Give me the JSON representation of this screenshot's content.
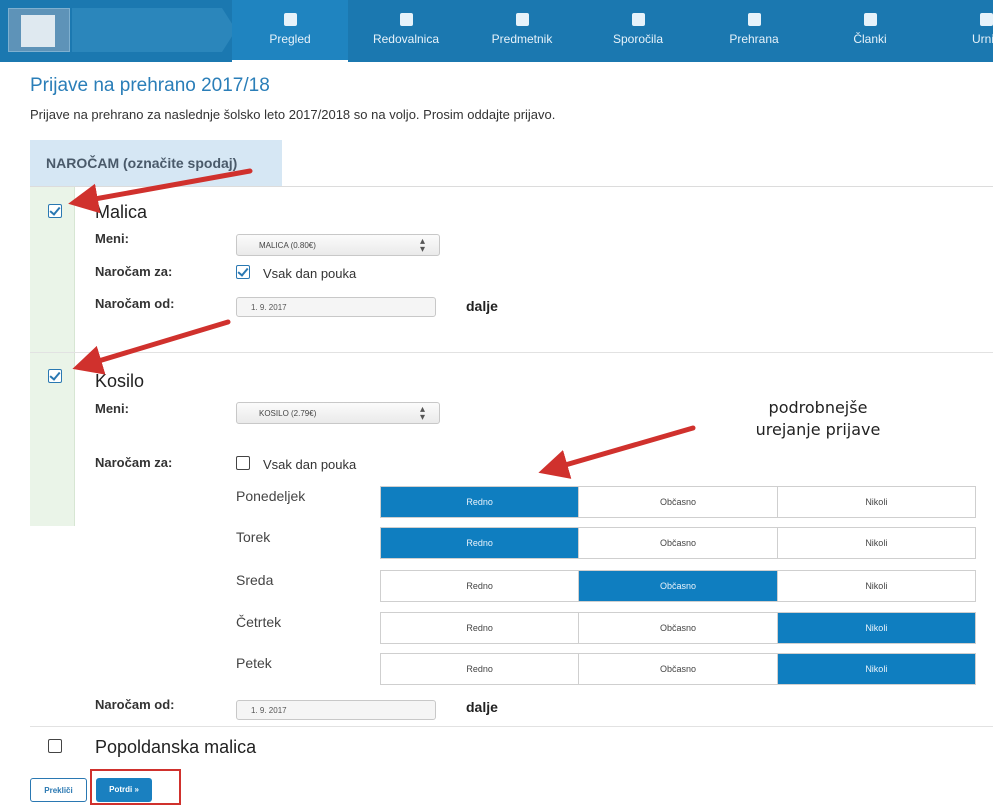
{
  "nav": {
    "items": [
      {
        "label": "Pregled",
        "icon": "box-icon",
        "active": true
      },
      {
        "label": "Redovalnica",
        "icon": "plus-square-icon",
        "active": false
      },
      {
        "label": "Predmetnik",
        "icon": "plus-square-icon",
        "active": false
      },
      {
        "label": "Sporočila",
        "icon": "chat-bubble-icon",
        "active": false
      },
      {
        "label": "Prehrana",
        "icon": "cutlery-icon",
        "active": false
      },
      {
        "label": "Članki",
        "icon": "plus-square-icon",
        "active": false
      },
      {
        "label": "Urnik",
        "icon": "calendar-icon",
        "active": false
      }
    ]
  },
  "page": {
    "title": "Prijave na prehrano 2017/18",
    "description": "Prijave na prehrano za naslednje šolsko leto 2017/2018 so na voljo. Prosim oddajte prijavo."
  },
  "tab": {
    "label": "NAROČAM (označite spodaj)"
  },
  "malica": {
    "name": "Malica",
    "checked": true,
    "meni_label": "Meni:",
    "meni_value": "MALICA (0.80€)",
    "narocam_za_label": "Naročam za:",
    "vsak_dan_label": "Vsak dan pouka",
    "vsak_dan_checked": true,
    "narocam_od_label": "Naročam od:",
    "narocam_od_value": "1. 9. 2017",
    "dalje": "dalje"
  },
  "kosilo": {
    "name": "Kosilo",
    "checked": true,
    "meni_label": "Meni:",
    "meni_value": "KOSILO (2.79€)",
    "narocam_za_label": "Naročam za:",
    "vsak_dan_label": "Vsak dan pouka",
    "vsak_dan_checked": false,
    "options": [
      "Redno",
      "Občasno",
      "Nikoli"
    ],
    "days": [
      {
        "name": "Ponedeljek",
        "selected": "Redno"
      },
      {
        "name": "Torek",
        "selected": "Redno"
      },
      {
        "name": "Sreda",
        "selected": "Občasno"
      },
      {
        "name": "Četrtek",
        "selected": "Nikoli"
      },
      {
        "name": "Petek",
        "selected": "Nikoli"
      }
    ],
    "narocam_od_label": "Naročam od:",
    "narocam_od_value": "1. 9. 2017",
    "dalje": "dalje"
  },
  "popoldanska": {
    "name": "Popoldanska malica",
    "checked": false
  },
  "annotation": {
    "line1": "podrobnejše",
    "line2": "urejanje prijave"
  },
  "buttons": {
    "cancel": "Prekliči",
    "confirm": "Potrdi »"
  },
  "colors": {
    "nav": "#1b78b0",
    "accent": "#0f7ec0",
    "annotation_red": "#d0312d"
  }
}
